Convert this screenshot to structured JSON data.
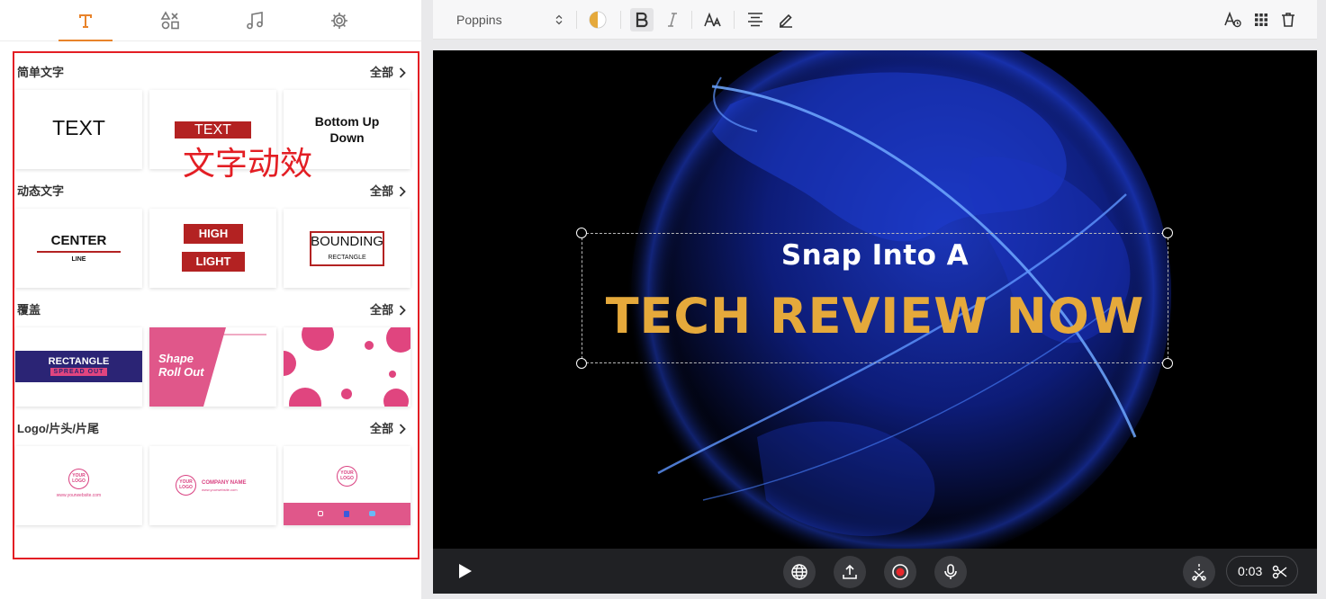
{
  "tabs": [
    {
      "icon": "text-icon",
      "active": true
    },
    {
      "icon": "shapes-icon",
      "active": false
    },
    {
      "icon": "music-icon",
      "active": false
    },
    {
      "icon": "gear-icon",
      "active": false
    }
  ],
  "annotation": "文字动效",
  "sections": [
    {
      "title": "简单文字",
      "all": "全部"
    },
    {
      "title": "动态文字",
      "all": "全部"
    },
    {
      "title": "覆盖",
      "all": "全部"
    },
    {
      "title": "Logo/片头/片尾",
      "all": "全部"
    }
  ],
  "cards": {
    "simple": [
      "TEXT",
      "TEXT",
      "Bottom Up Down"
    ],
    "dynamic": {
      "center": "CENTER",
      "line": "LINE",
      "high": "HIGH",
      "light": "LIGHT",
      "bounding": "BOUNDING",
      "rectangle": "RECTANGLE"
    },
    "overlay": {
      "rect_top": "RECTANGLE",
      "rect_bottom": "SPREAD OUT",
      "shape1": "Shape",
      "shape2": "Roll Out"
    },
    "logo": {
      "your": "YOUR",
      "logo": "LOGO",
      "website": "www.yourwebsite.com",
      "company": "COMPANY NAME",
      "company_sub": "www.yourwebsite.com"
    }
  },
  "toolbar": {
    "font": "Poppins",
    "accent_color": "#e5a93b",
    "buttons": [
      "color-icon",
      "bold-icon",
      "italic-icon",
      "font-size-icon",
      "align-center-icon",
      "pen-icon",
      "text-style-icon",
      "grid-icon",
      "trash-icon"
    ]
  },
  "canvas": {
    "line1": "Snap Into A",
    "line2": "TECH REVIEW NOW",
    "line2_color": "#e5a93b"
  },
  "bottombar": {
    "time": "0:03",
    "buttons": [
      "play-icon",
      "globe-icon",
      "upload-icon",
      "record-icon",
      "mic-icon",
      "split-icon",
      "scissors-icon"
    ]
  }
}
